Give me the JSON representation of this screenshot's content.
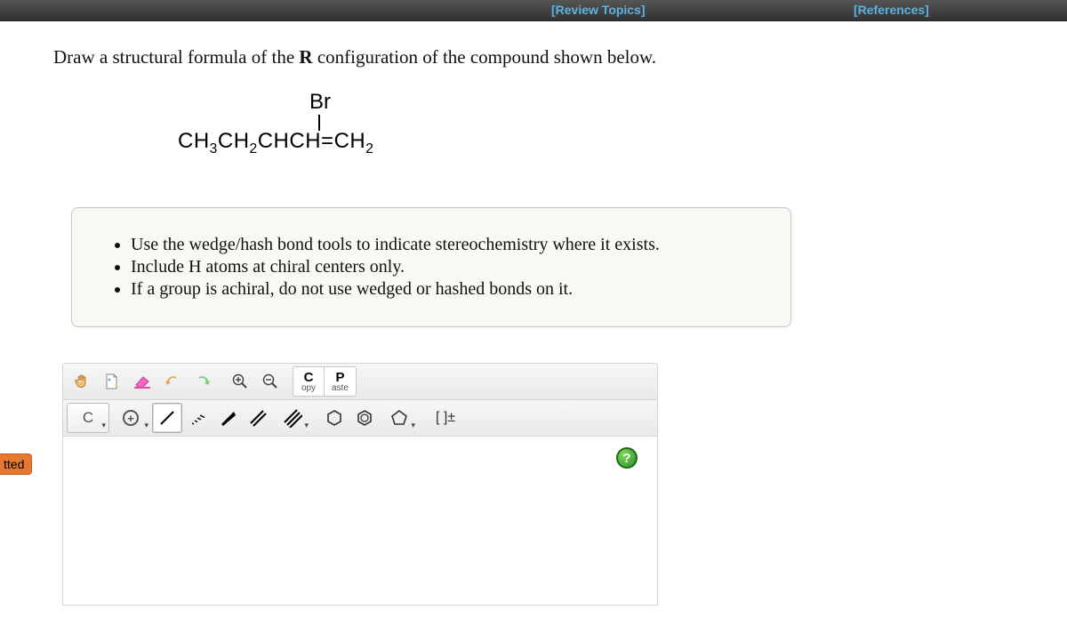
{
  "topbar": {
    "review": "[Review Topics]",
    "references": "[References]"
  },
  "question": {
    "pre": "Draw a structural formula of the ",
    "bold": "R",
    "post": " configuration of the compound shown below."
  },
  "molecule": {
    "br": "Br",
    "formula_html": "CH<sub>3</sub>CH<sub>2</sub>CHCH=CH<sub>2</sub>"
  },
  "instructions": {
    "items": [
      "Use the wedge/hash bond tools to indicate stereochemistry where it exists.",
      "Include H atoms at chiral centers only.",
      "If a group is achiral, do not use wedged or hashed bonds on it."
    ]
  },
  "toolbar": {
    "copy_big": "C",
    "copy_small": "opy",
    "paste_big": "P",
    "paste_small": "aste",
    "element_label": "C",
    "charge_label": "[ ]±",
    "help": "?"
  },
  "side_tab": "tted"
}
